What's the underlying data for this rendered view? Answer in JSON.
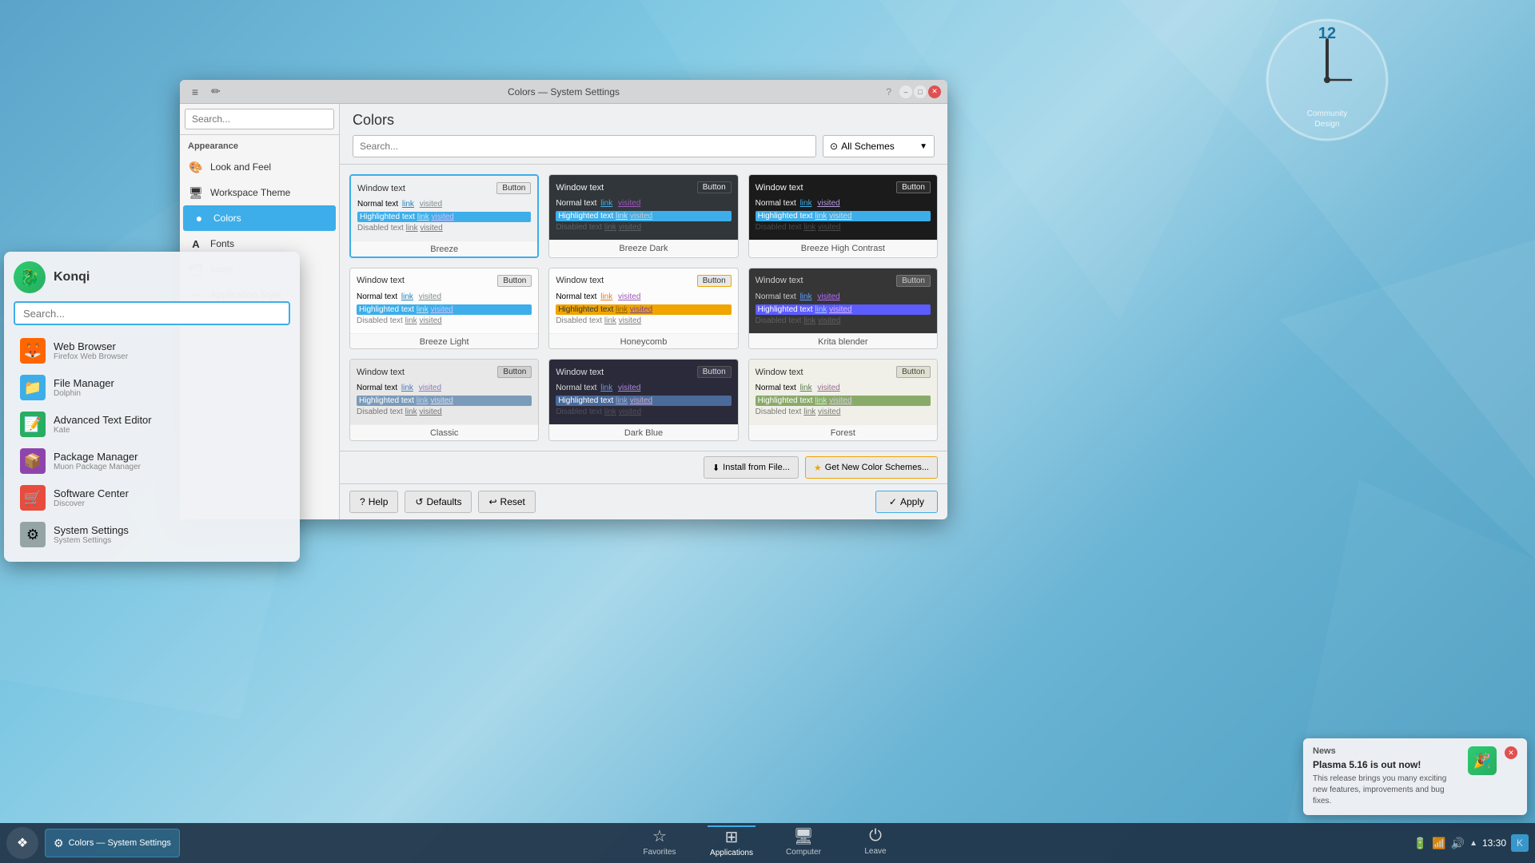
{
  "window": {
    "title": "Colors — System Settings",
    "titlebar_left_icon": "≡",
    "min_btn": "–",
    "max_btn": "□",
    "close_btn": "✕"
  },
  "sidebar": {
    "search_placeholder": "Search...",
    "section_label": "Appearance",
    "items": [
      {
        "id": "look-feel",
        "label": "Look and Feel",
        "icon": "🎨"
      },
      {
        "id": "workspace-theme",
        "label": "Workspace Theme",
        "icon": "🖥"
      },
      {
        "id": "colors",
        "label": "Colors",
        "icon": "🔵"
      },
      {
        "id": "fonts",
        "label": "Fonts",
        "icon": "A"
      },
      {
        "id": "icons",
        "label": "Icons",
        "icon": "🗂"
      },
      {
        "id": "application-style",
        "label": "Application Style",
        "icon": "✏"
      }
    ]
  },
  "main": {
    "title": "Colors",
    "search_placeholder": "Search...",
    "scheme_dropdown_label": "All Schemes",
    "schemes": [
      {
        "id": "breeze",
        "name": "Breeze",
        "theme": "breeze",
        "window_text": "Window text",
        "button_label": "Button",
        "normal_text": "Normal text",
        "link_label": "link",
        "visited_label": "visited",
        "highlighted_text": "Highlighted text",
        "hl_link": "link",
        "hl_visited": "visited",
        "disabled_text": "Disabled text",
        "dis_link": "link",
        "dis_visited": "visited"
      },
      {
        "id": "breeze-dark",
        "name": "Breeze Dark",
        "theme": "breeze-dark",
        "window_text": "Window text",
        "button_label": "Button",
        "normal_text": "Normal text",
        "link_label": "link",
        "visited_label": "visited",
        "highlighted_text": "Highlighted text",
        "hl_link": "link",
        "hl_visited": "visited",
        "disabled_text": "Disabled text",
        "dis_link": "link",
        "dis_visited": "visited"
      },
      {
        "id": "breeze-hc",
        "name": "Breeze High Contrast",
        "theme": "breeze-hc",
        "window_text": "Window text",
        "button_label": "Button",
        "normal_text": "Normal text",
        "link_label": "link",
        "visited_label": "visited",
        "highlighted_text": "Highlighted text",
        "hl_link": "link",
        "hl_visited": "visited",
        "disabled_text": "Disabled text",
        "dis_link": "link",
        "dis_visited": "visited"
      },
      {
        "id": "breeze-light",
        "name": "Breeze Light",
        "theme": "breeze-light",
        "window_text": "Window text",
        "button_label": "Button",
        "normal_text": "Normal text",
        "link_label": "link",
        "visited_label": "visited",
        "highlighted_text": "Highlighted text",
        "hl_link": "link",
        "hl_visited": "visited",
        "disabled_text": "Disabled text",
        "dis_link": "link",
        "dis_visited": "visited"
      },
      {
        "id": "honeycomb",
        "name": "Honeycomb",
        "theme": "honeycomb",
        "window_text": "Window text",
        "button_label": "Button",
        "normal_text": "Normal text",
        "link_label": "link",
        "visited_label": "visited",
        "highlighted_text": "Highlighted text",
        "hl_link": "link",
        "hl_visited": "visited",
        "disabled_text": "Disabled text",
        "dis_link": "link",
        "dis_visited": "visited"
      },
      {
        "id": "krita",
        "name": "Krita blender",
        "theme": "krita",
        "window_text": "Window text",
        "button_label": "Button",
        "normal_text": "Normal text",
        "link_label": "link",
        "visited_label": "visited",
        "highlighted_text": "Highlighted text",
        "hl_link": "link",
        "hl_visited": "visited",
        "disabled_text": "Disabled text",
        "dis_link": "link",
        "dis_visited": "visited"
      },
      {
        "id": "theme-r3a",
        "name": "Classic",
        "theme": "theme-r3a",
        "window_text": "Window text",
        "button_label": "Button",
        "normal_text": "Normal text",
        "link_label": "link",
        "visited_label": "visited",
        "highlighted_text": "Highlighted text",
        "hl_link": "link",
        "hl_visited": "visited",
        "disabled_text": "Disabled text",
        "dis_link": "link",
        "dis_visited": "visited"
      },
      {
        "id": "theme-r3b",
        "name": "Dark Blue",
        "theme": "theme-r3b",
        "window_text": "Window text",
        "button_label": "Button",
        "normal_text": "Normal text",
        "link_label": "link",
        "visited_label": "visited",
        "highlighted_text": "Highlighted text",
        "hl_link": "link",
        "hl_visited": "visited",
        "disabled_text": "Disabled text",
        "dis_link": "link",
        "dis_visited": "visited"
      },
      {
        "id": "theme-r3c",
        "name": "Forest",
        "theme": "theme-r3c",
        "window_text": "Window text",
        "button_label": "Button",
        "normal_text": "Normal text",
        "link_label": "link",
        "visited_label": "visited",
        "highlighted_text": "Highlighted text",
        "hl_link": "link",
        "hl_visited": "visited",
        "disabled_text": "Disabled text",
        "dis_link": "link",
        "dis_visited": "visited"
      }
    ],
    "footer": {
      "help_label": "Help",
      "defaults_label": "Defaults",
      "reset_label": "Reset",
      "install_label": "Install from File...",
      "get_new_label": "Get New Color Schemes...",
      "apply_label": "Apply"
    }
  },
  "konqi": {
    "name": "Konqi",
    "search_placeholder": "Search...",
    "apps": [
      {
        "id": "web-browser",
        "name": "Web Browser",
        "sub": "Firefox Web Browser",
        "icon": "🦊"
      },
      {
        "id": "file-manager",
        "name": "File Manager",
        "sub": "Dolphin",
        "icon": "📁"
      },
      {
        "id": "text-editor",
        "name": "Advanced Text Editor",
        "sub": "Kate",
        "icon": "📝"
      },
      {
        "id": "package-manager",
        "name": "Package Manager",
        "sub": "Muon Package Manager",
        "icon": "📦"
      },
      {
        "id": "software-center",
        "name": "Software Center",
        "sub": "Discover",
        "icon": "🛒"
      },
      {
        "id": "system-settings",
        "name": "System Settings",
        "sub": "System Settings",
        "icon": "⚙"
      }
    ]
  },
  "taskbar": {
    "launcher_icon": "❖",
    "active_window": "Colors — System Settings",
    "nav_items": [
      {
        "id": "favorites",
        "label": "Favorites",
        "icon": "☆"
      },
      {
        "id": "applications",
        "label": "Applications",
        "icon": "⊞"
      },
      {
        "id": "computer",
        "label": "Computer",
        "icon": "🖥"
      },
      {
        "id": "leave",
        "label": "Leave",
        "icon": "⏻"
      }
    ],
    "system_tray": {
      "icons": [
        "🔋",
        "📶",
        "🔊",
        "▲"
      ],
      "time": "13:30"
    }
  },
  "notification": {
    "title": "News",
    "headline": "Plasma 5.16 is out now!",
    "body": "This release brings you many exciting new features, improvements and bug fixes.",
    "icon": "🎉"
  },
  "clock": {
    "number_12": "12",
    "community_text": "Community\nDesign"
  }
}
